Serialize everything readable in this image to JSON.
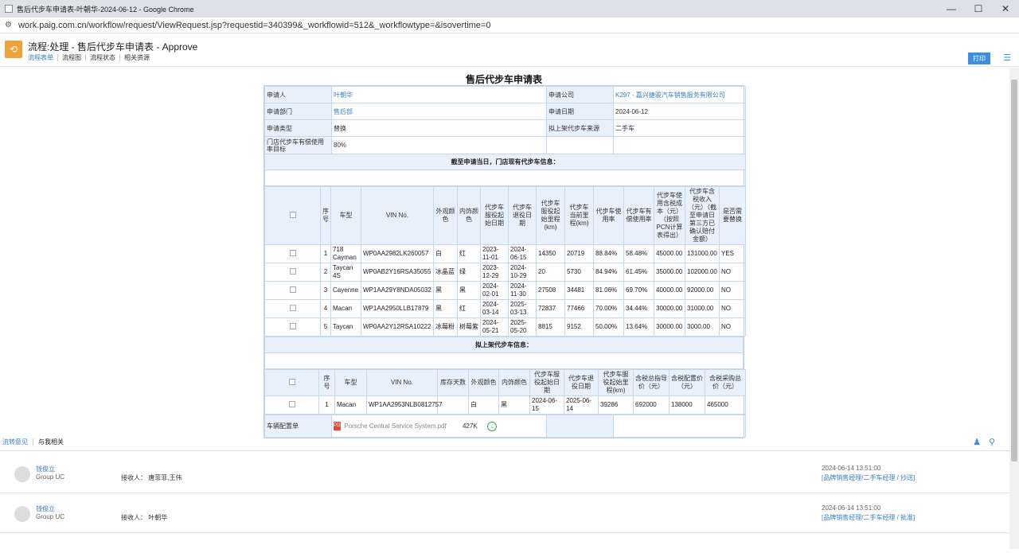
{
  "window": {
    "title": "售后代步车申请表-叶朝华-2024-06-12 - Google Chrome",
    "url": "work.paig.com.cn/workflow/request/ViewRequest.jsp?requestid=340399&_workflowid=512&_workflowtype=&isovertime=0",
    "minimize": "—",
    "maximize": "☐",
    "close": "✕"
  },
  "app": {
    "title": "流程:处理 - 售后代步车申请表 - Approve",
    "tabs": [
      "流程表单",
      "流程图",
      "流程状态",
      "相关资源"
    ],
    "print_label": "打印"
  },
  "form": {
    "title": "售后代步车申请表",
    "applicant_label": "申请人",
    "applicant": "叶朝华",
    "company_label": "申请公司",
    "company": "K297 - 嘉兴捷骏汽车销售服务有限公司",
    "dept_label": "申请部门",
    "dept": "售后部",
    "date_label": "申请日期",
    "date": "2024-06-12",
    "type_label": "申请类型",
    "type": "替换",
    "source_label": "拟上架代步车来源",
    "source": "二手车",
    "target_label": "门店代步车有偿使用率目标",
    "target": "80%",
    "section1": "截至申请当日，门店现有代步车信息：",
    "section2": "拟上架代步车信息：",
    "attach_label": "车辆配置单",
    "attach_name": "Porsche Central Service System.pdf",
    "attach_size": "427K"
  },
  "current": {
    "headers": [
      "序号",
      "车型",
      "VIN No.",
      "外观颜色",
      "内饰颜色",
      "代步车服役起始日期",
      "代步车退役日期",
      "代步车服役起始里程(km)",
      "代步车当前里程(km)",
      "代步车使用率",
      "代步车有偿使用率",
      "代步车使用含税成本（元）（按照PCN计算表得出）",
      "代步车含税收入（元）（截至申请日第三方已确认赔付金额）",
      "是否需要替换"
    ],
    "rows": [
      [
        "1",
        "718 Cayman",
        "WP0AA2982LK260057",
        "白",
        "红",
        "2023-11-01",
        "2024-06-15",
        "14350",
        "20719",
        "88.84%",
        "58.48%",
        "45000.00",
        "131000.00",
        "YES"
      ],
      [
        "2",
        "Taycan 4S",
        "WP0AB2Y16RSA35055",
        "冰晶蓝",
        "绿",
        "2023-12-29",
        "2024-10-29",
        "20",
        "5730",
        "84.94%",
        "61.45%",
        "35000.00",
        "102000.00",
        "NO"
      ],
      [
        "3",
        "Cayenne",
        "WP1AA29Y8NDA05032",
        "黑",
        "黑",
        "2024-02-01",
        "2024-11-30",
        "27508",
        "34481",
        "81.06%",
        "69.70%",
        "40000.00",
        "92000.00",
        "NO"
      ],
      [
        "4",
        "Macan",
        "WP1AA2950LLB17879",
        "黑",
        "红",
        "2024-03-14",
        "2025-03-13",
        "72837",
        "77466",
        "70.00%",
        "34.44%",
        "30000.00",
        "31000.00",
        "NO"
      ],
      [
        "5",
        "Taycan",
        "WP0AA2Y12RSA10222",
        "冰莓粉",
        "树莓紫",
        "2024-05-21",
        "2025-05-20",
        "8815",
        "9152",
        "50.00%",
        "13.64%",
        "30000.00",
        "3000.00",
        "NO"
      ]
    ]
  },
  "proposed": {
    "headers": [
      "序号",
      "车型",
      "VIN No.",
      "库存天数",
      "外观颜色",
      "内饰颜色",
      "代步车服役起始日期",
      "代步车退役日期",
      "代步车服役起始里程(km)",
      "含税总指导价（元）",
      "含税配置价（元）",
      "含税采购总价（元）"
    ],
    "rows": [
      [
        "1",
        "Macan",
        "WP1AA2953NLB0812757",
        "",
        "白",
        "黑",
        "2024-06-15",
        "2025-06-14",
        "39286",
        "692000",
        "138000",
        "465000"
      ]
    ]
  },
  "opinions": {
    "tabs": [
      "流转意见",
      "与我相关"
    ],
    "items": [
      {
        "name": "钱俊立",
        "group": "Group UC",
        "receiver": "接收人： 唐菲菲,王伟",
        "time": "2024-06-14  13:51:00",
        "role": "[品牌销售经理/二手车经理 / 抄送]"
      },
      {
        "name": "钱俊立",
        "group": "Group UC",
        "receiver": "接收人： 叶朝华",
        "time": "2024-06-14  13:51:00",
        "role": "[品牌销售经理/二手车经理 / 批准]"
      }
    ]
  }
}
